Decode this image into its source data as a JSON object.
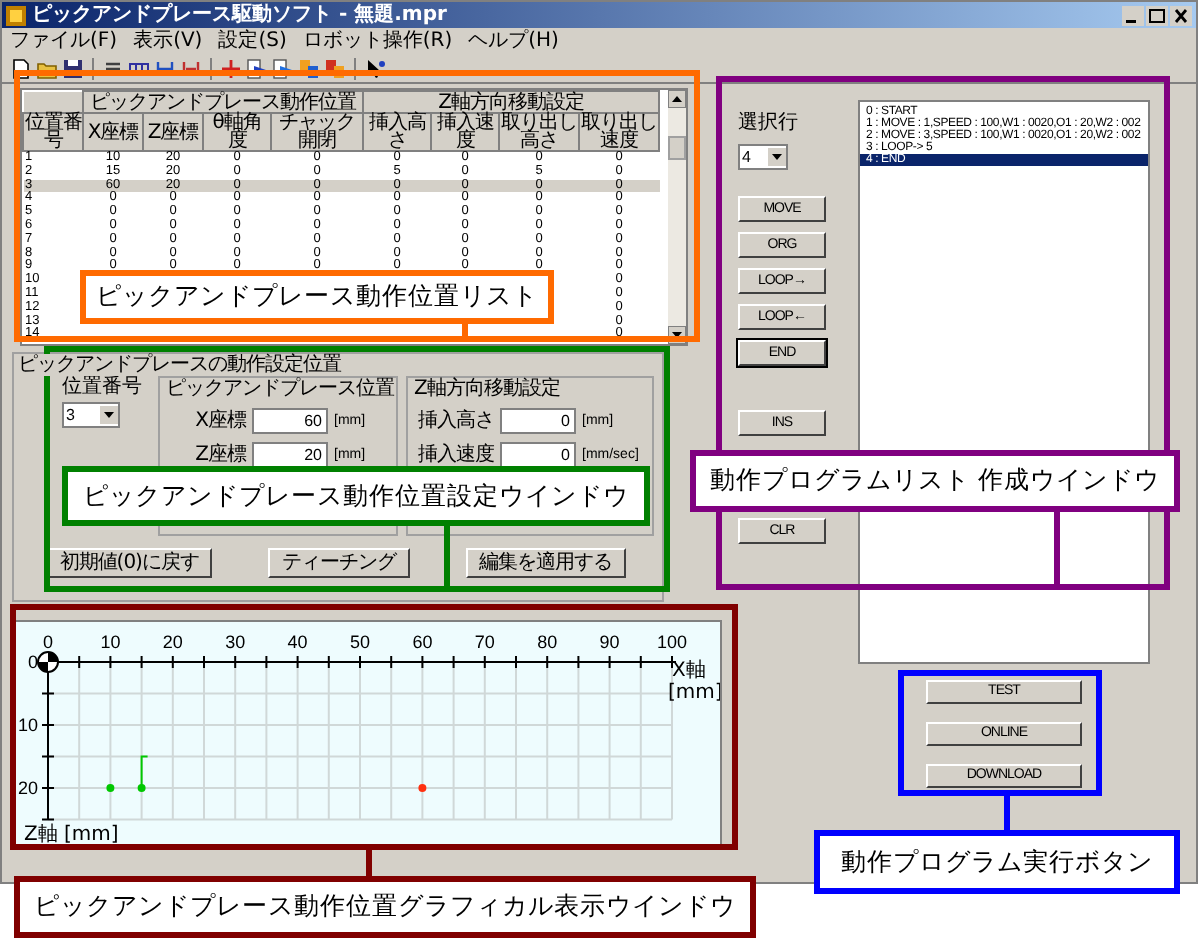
{
  "window": {
    "title": "ピックアンドプレース駆動ソフト - 無題.mpr"
  },
  "menu": [
    "ファイル(F)",
    "表示(V)",
    "設定(S)",
    "ロボット操作(R)",
    "ヘルプ(H)"
  ],
  "position_table": {
    "groups": [
      "ピックアンドプレース動作位置",
      "Z軸方向移動設定"
    ],
    "columns": [
      "位置番号",
      "X座標",
      "Z座標",
      "θ軸角度",
      "チャック開閉",
      "挿入高さ",
      "挿入速度",
      "取り出し高さ",
      "取り出し速度"
    ],
    "rows": [
      {
        "cells": [
          "1",
          "10",
          "20",
          "0",
          "0",
          "0",
          "0",
          "0",
          "0"
        ],
        "selected": false
      },
      {
        "cells": [
          "2",
          "15",
          "20",
          "0",
          "0",
          "5",
          "0",
          "5",
          "0"
        ],
        "selected": false
      },
      {
        "cells": [
          "3",
          "60",
          "20",
          "0",
          "0",
          "0",
          "0",
          "0",
          "0"
        ],
        "selected": true
      },
      {
        "cells": [
          "4",
          "0",
          "0",
          "0",
          "0",
          "0",
          "0",
          "0",
          "0"
        ],
        "selected": false
      },
      {
        "cells": [
          "5",
          "0",
          "0",
          "0",
          "0",
          "0",
          "0",
          "0",
          "0"
        ],
        "selected": false
      },
      {
        "cells": [
          "6",
          "0",
          "0",
          "0",
          "0",
          "0",
          "0",
          "0",
          "0"
        ],
        "selected": false
      },
      {
        "cells": [
          "7",
          "0",
          "0",
          "0",
          "0",
          "0",
          "0",
          "0",
          "0"
        ],
        "selected": false
      },
      {
        "cells": [
          "8",
          "0",
          "0",
          "0",
          "0",
          "0",
          "0",
          "0",
          "0"
        ],
        "selected": false
      },
      {
        "cells": [
          "9",
          "0",
          "0",
          "0",
          "0",
          "0",
          "0",
          "0",
          "0"
        ],
        "selected": false
      },
      {
        "cells": [
          "10",
          null,
          null,
          null,
          null,
          null,
          null,
          null,
          "0"
        ],
        "selected": false
      },
      {
        "cells": [
          "11",
          null,
          null,
          null,
          null,
          null,
          null,
          null,
          "0"
        ],
        "selected": false
      },
      {
        "cells": [
          "12",
          null,
          null,
          null,
          null,
          null,
          null,
          null,
          "0"
        ],
        "selected": false
      },
      {
        "cells": [
          "13",
          null,
          null,
          null,
          null,
          null,
          null,
          null,
          "0"
        ],
        "selected": false
      },
      {
        "cells": [
          "14",
          null,
          null,
          null,
          null,
          null,
          null,
          null,
          "0"
        ],
        "selected": false
      }
    ]
  },
  "position_settings": {
    "title": "ピックアンドプレースの動作設定位置",
    "position_number": {
      "label": "位置番号",
      "value": "3"
    },
    "position_group": {
      "title": "ピックアンドプレース位置",
      "fields": [
        {
          "label": "X座標",
          "value": "60",
          "unit": "[mm]"
        },
        {
          "label": "Z座標",
          "value": "20",
          "unit": "[mm]"
        }
      ]
    },
    "z_group": {
      "title": "Z軸方向移動設定",
      "fields": [
        {
          "label": "挿入高さ",
          "value": "0",
          "unit": "[mm]"
        },
        {
          "label": "挿入速度",
          "value": "0",
          "unit": "[mm/sec]"
        }
      ]
    },
    "buttons": [
      "初期値(0)に戻す",
      "ティーチング",
      "編集を適用する"
    ]
  },
  "program": {
    "selected_line": {
      "label": "選択行",
      "value": "4"
    },
    "buttons": [
      {
        "label": "MOVE",
        "default": false
      },
      {
        "label": "ORG",
        "default": false
      },
      {
        "label": "LOOP→",
        "default": false
      },
      {
        "label": "LOOP←",
        "default": false
      },
      {
        "label": "END",
        "default": true
      },
      {
        "label": "INS",
        "default": false
      },
      {
        "label": "CLR",
        "default": false
      }
    ],
    "lines": [
      {
        "text": "0 : START",
        "selected": false
      },
      {
        "text": "1 : MOVE : 1,SPEED : 100,W1 : 0020,O1 : 20,W2 : 002",
        "selected": false
      },
      {
        "text": "2 : MOVE : 3,SPEED : 100,W1 : 0020,O1 : 20,W2 : 002",
        "selected": false
      },
      {
        "text": "3 : LOOP-> 5",
        "selected": false
      },
      {
        "text": "4 : END",
        "selected": true
      }
    ]
  },
  "execute_buttons": [
    "TEST",
    "ONLINE",
    "DOWNLOAD"
  ],
  "graph": {
    "chart_data": {
      "type": "scatter",
      "xlabel": "X軸 [mm]",
      "ylabel": "Z軸 [mm]",
      "xlim": [
        0,
        100
      ],
      "ylim": [
        25,
        0
      ],
      "xticks": [
        0,
        10,
        20,
        30,
        40,
        50,
        60,
        70,
        80,
        90,
        100
      ],
      "yticks": [
        0,
        10,
        20
      ],
      "series": [
        {
          "color": "#00c800",
          "x": [
            10,
            15
          ],
          "values": [
            20,
            20
          ]
        },
        {
          "color": "#ff3010",
          "x": [
            60
          ],
          "values": [
            20
          ]
        }
      ],
      "grid": true
    }
  },
  "callouts": [
    {
      "label": "ピックアンドプレース動作位置リスト",
      "color": "#ff6a00"
    },
    {
      "label": "ピックアンドプレース動作位置設定ウインドウ",
      "color": "#008000"
    },
    {
      "label": "動作プログラムリスト 作成ウインドウ",
      "color": "#800080"
    },
    {
      "label": "ピックアンドプレース動作位置グラフィカル表示ウインドウ",
      "color": "#800000"
    },
    {
      "label": "動作プログラム実行ボタン",
      "color": "#0000ff"
    }
  ]
}
